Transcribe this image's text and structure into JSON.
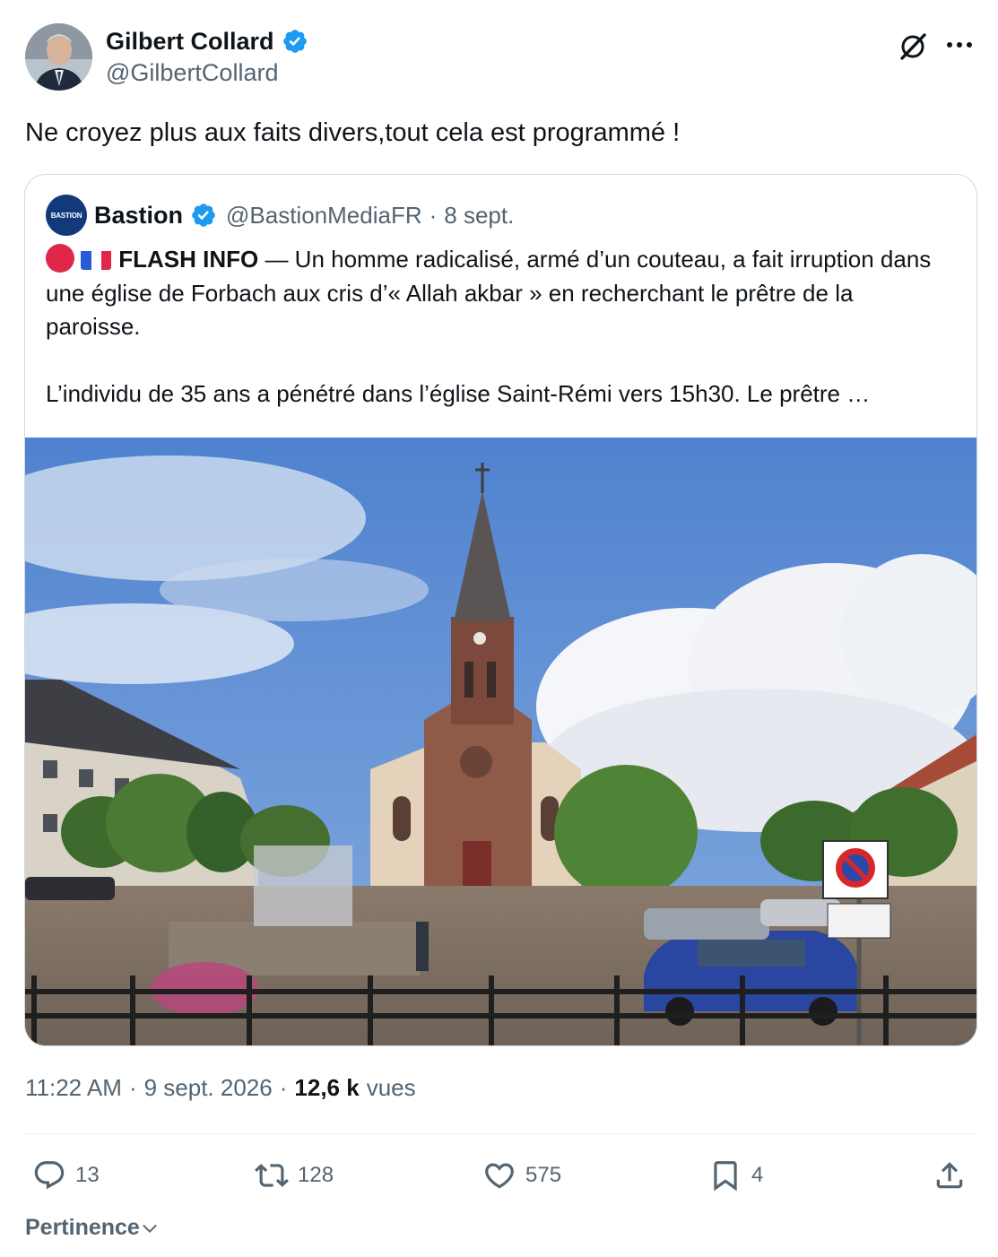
{
  "author": {
    "display_name": "Gilbert Collard",
    "handle": "@GilbertCollard",
    "verified": true
  },
  "tweet": {
    "text": "Ne croyez plus aux faits divers,tout cela est programmé !"
  },
  "quoted": {
    "avatar_text": "BASTION",
    "display_name": "Bastion",
    "handle": "@BastionMediaFR",
    "separator": "·",
    "date": "8 sept.",
    "flash_label": "FLASH INFO",
    "line1_rest": " — Un homme radicalisé, armé d’un couteau, a fait irruption dans une église de Forbach aux cris d’« Allah akbar » en recherchant le prêtre de la paroisse.",
    "line2": "L’individu de 35 ans a pénétré dans l’église Saint-Rémi vers 15h30. Le prêtre …",
    "photo_icon": "church-photo"
  },
  "meta": {
    "time": "11:22 AM",
    "sep1": "·",
    "date": "9 sept. 2026",
    "sep2": "·",
    "views_count": "12,6 k",
    "views_label": "vues"
  },
  "actions": {
    "replies": "13",
    "retweets": "128",
    "likes": "575",
    "bookmarks": "4"
  },
  "sort": {
    "label": "Pertinence"
  },
  "colors": {
    "verified_blue": "#1d9bf0",
    "secondary_text": "#536471",
    "primary_text": "#0f1419"
  },
  "icons": [
    "verified-badge-icon",
    "grok-icon",
    "more-icon",
    "reply-icon",
    "retweet-icon",
    "like-icon",
    "bookmark-icon",
    "share-icon",
    "chevron-down-icon"
  ]
}
